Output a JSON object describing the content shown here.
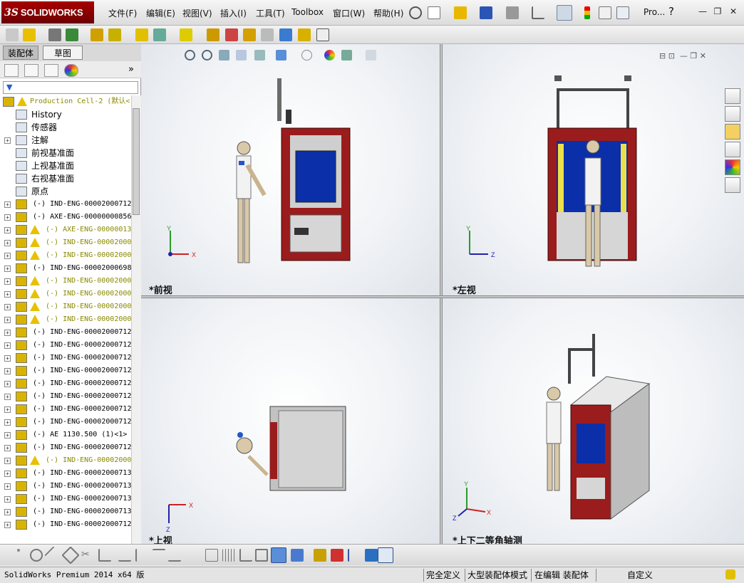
{
  "app": {
    "logo_ds": "3S",
    "logo_name": "SOLIDWORKS"
  },
  "menu": [
    {
      "label": "文件(F)"
    },
    {
      "label": "编辑(E)"
    },
    {
      "label": "视图(V)"
    },
    {
      "label": "插入(I)"
    },
    {
      "label": "工具(T)"
    },
    {
      "label": "Toolbox"
    },
    {
      "label": "窗口(W)"
    },
    {
      "label": "帮助(H)"
    }
  ],
  "quick_search_label": "Pro...",
  "left_panel": {
    "tabs": [
      {
        "label": "装配体"
      },
      {
        "label": "草图"
      }
    ],
    "tree": [
      {
        "text": "Production Cell-2  (默认<",
        "warn": true,
        "expand": false,
        "kind": "root"
      },
      {
        "text": "History",
        "kind": "cn"
      },
      {
        "text": "传感器",
        "kind": "cn"
      },
      {
        "text": "注解",
        "kind": "cn",
        "expand": true
      },
      {
        "text": "前视基准面",
        "kind": "cn"
      },
      {
        "text": "上视基准面",
        "kind": "cn"
      },
      {
        "text": "右视基准面",
        "kind": "cn"
      },
      {
        "text": "原点",
        "kind": "cn"
      },
      {
        "text": "(-) IND-ENG-00002000712",
        "expand": true
      },
      {
        "text": "(-) AXE-ENG-00000000856",
        "expand": true
      },
      {
        "text": "(-) AXE-ENG-00000013",
        "expand": true,
        "warn": true
      },
      {
        "text": "(-) IND-ENG-000020000",
        "expand": true,
        "warn": true
      },
      {
        "text": "(-) IND-ENG-000020000",
        "expand": true,
        "warn": true
      },
      {
        "text": "(-) IND-ENG-00002000698",
        "expand": true
      },
      {
        "text": "(-) IND-ENG-000020007",
        "expand": true,
        "warn": true
      },
      {
        "text": "(-) IND-ENG-000020007",
        "expand": true,
        "warn": true
      },
      {
        "text": "(-) IND-ENG-000020007",
        "expand": true,
        "warn": true
      },
      {
        "text": "(-) IND-ENG-000020007",
        "expand": true,
        "warn": true
      },
      {
        "text": "(-) IND-ENG-00002000712",
        "expand": true
      },
      {
        "text": "(-) IND-ENG-00002000712",
        "expand": true
      },
      {
        "text": "(-) IND-ENG-00002000712",
        "expand": true
      },
      {
        "text": "(-) IND-ENG-00002000712",
        "expand": true
      },
      {
        "text": "(-) IND-ENG-00002000712",
        "expand": true
      },
      {
        "text": "(-) IND-ENG-00002000712",
        "expand": true
      },
      {
        "text": "(-) IND-ENG-00002000712",
        "expand": true
      },
      {
        "text": "(-) IND-ENG-00002000712",
        "expand": true
      },
      {
        "text": "(-) AE 1130.500  (1)<1>",
        "expand": true
      },
      {
        "text": "(-) IND-ENG-00002000712",
        "expand": true
      },
      {
        "text": "(-) IND-ENG-000020000",
        "expand": true,
        "warn": true
      },
      {
        "text": "(-) IND-ENG-00002000713",
        "expand": true
      },
      {
        "text": "(-) IND-ENG-00002000713",
        "expand": true
      },
      {
        "text": "(-) IND-ENG-00002000713",
        "expand": true
      },
      {
        "text": "(-) IND-ENG-00002000713",
        "expand": true
      },
      {
        "text": "(-) IND-ENG-00002000712",
        "expand": true
      }
    ]
  },
  "viewports": [
    {
      "label": "*前视",
      "axes": [
        "Y",
        "X"
      ]
    },
    {
      "label": "*左视",
      "axes": [
        "Y",
        "Z"
      ]
    },
    {
      "label": "*上视",
      "axes": [
        "X",
        "Z"
      ]
    },
    {
      "label": "*上下二等角轴测",
      "axes": [
        "Y",
        "Z",
        "X"
      ]
    }
  ],
  "status": {
    "product": "SolidWorks Premium 2014 x64 版",
    "cells": [
      "完全定义",
      "大型装配体模式",
      "在编辑 装配体",
      "自定义"
    ]
  },
  "colors": {
    "frame_red": "#9b1c1c",
    "screen_blue": "#0a2fa8",
    "accent": "#c00000"
  }
}
